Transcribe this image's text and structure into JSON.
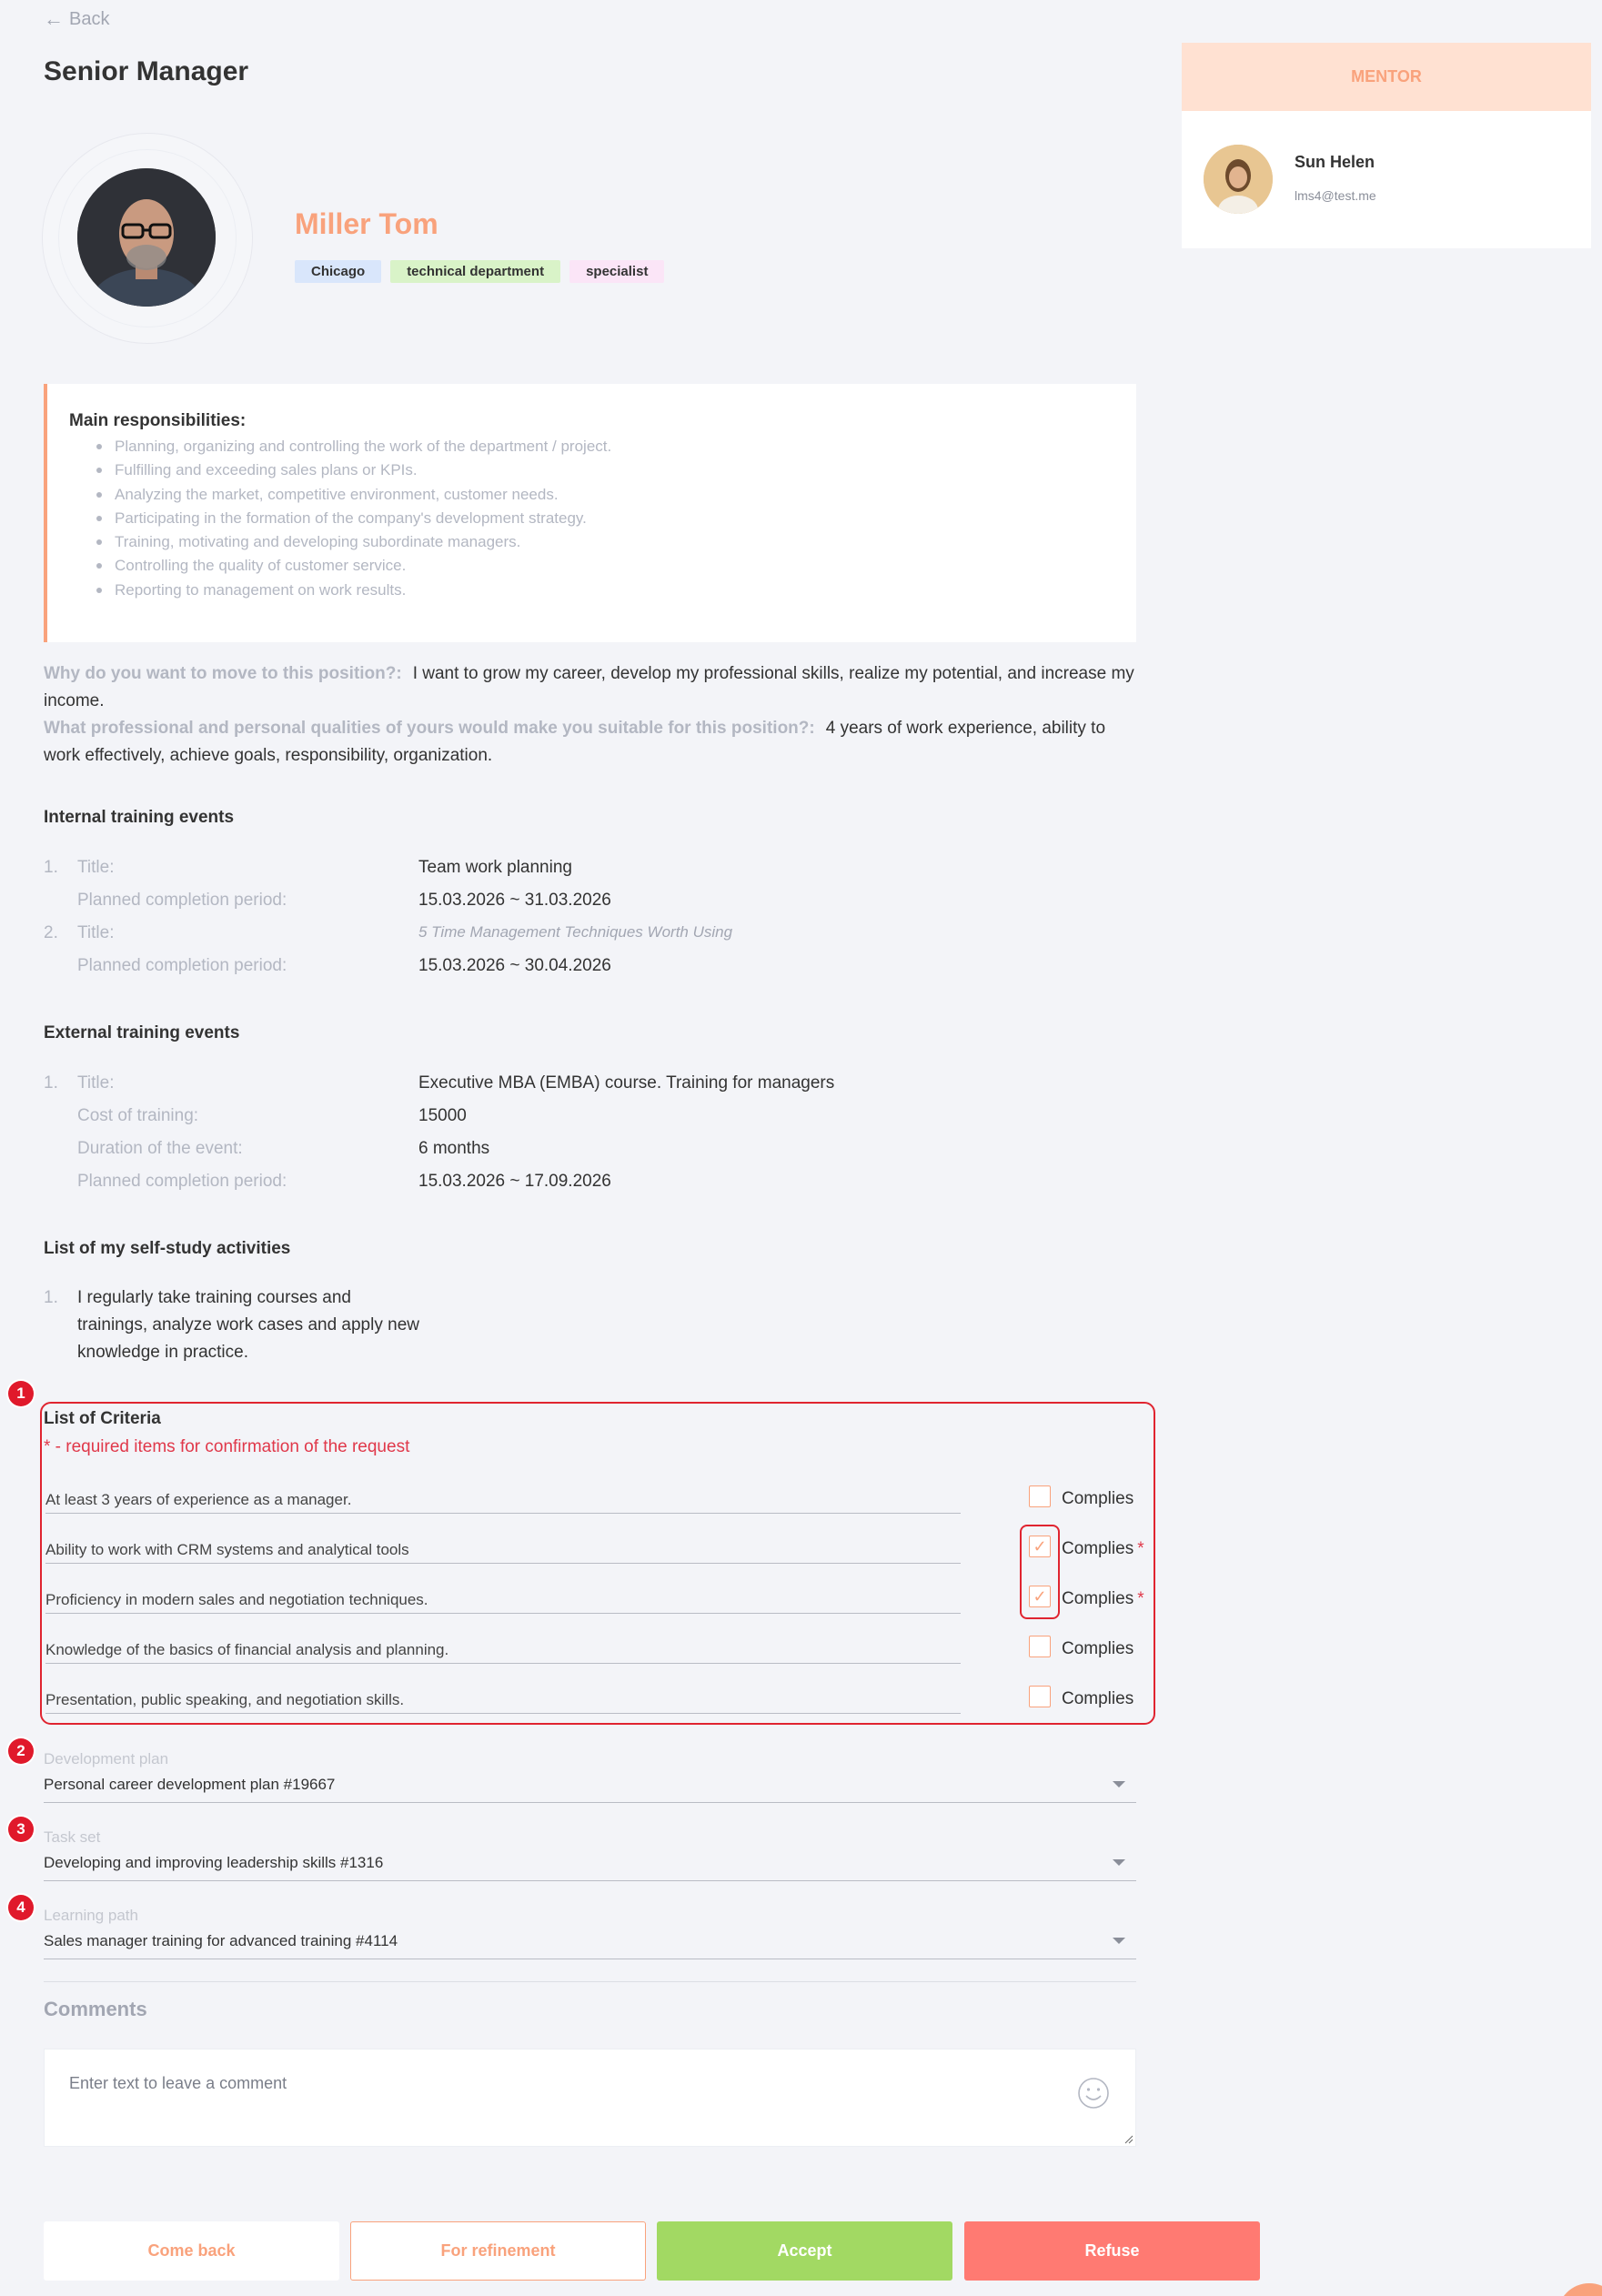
{
  "header": {
    "back_label": "Back",
    "page_title": "Senior Manager"
  },
  "profile": {
    "name": "Miller Tom",
    "tags": [
      "Chicago",
      "technical department",
      "specialist"
    ]
  },
  "mentor": {
    "heading": "MENTOR",
    "name": "Sun Helen",
    "email": "lms4@test.me"
  },
  "responsibilities": {
    "title": "Main responsibilities:",
    "items": [
      "Planning, organizing and controlling the work of the department / project.",
      "Fulfilling and exceeding sales plans or KPIs.",
      "Analyzing the market, competitive environment, customer needs.",
      "Participating in the formation of the company's development strategy.",
      "Training, motivating and developing subordinate managers.",
      "Controlling the quality of customer service.",
      "Reporting to management on work results."
    ]
  },
  "qa": [
    {
      "question": "Why do you want to move to this position?:",
      "answer": "I want to grow my career, develop my professional skills, realize my potential, and increase my income."
    },
    {
      "question": "What professional and personal qualities of yours would make you suitable for this position?:",
      "answer": "4 years of work experience, ability to work effectively, achieve goals, responsibility, organization."
    }
  ],
  "internal_training": {
    "title": "Internal training events",
    "rows": [
      {
        "num": "1.",
        "label": "Title:",
        "value": "Team work planning"
      },
      {
        "num": "",
        "label": "Planned completion period:",
        "value": "15.03.2026 ~ 31.03.2026"
      },
      {
        "num": "2.",
        "label": "Title:",
        "value": "5 Time Management Techniques Worth Using"
      },
      {
        "num": "",
        "label": "Planned completion period:",
        "value": "15.03.2026 ~ 30.04.2026"
      }
    ]
  },
  "external_training": {
    "title": "External training events",
    "rows": [
      {
        "num": "1.",
        "label": "Title:",
        "value": "Executive MBA (EMBA) course. Training for managers"
      },
      {
        "num": "",
        "label": "Cost of training:",
        "value": "15000"
      },
      {
        "num": "",
        "label": "Duration of the event:",
        "value": "6 months"
      },
      {
        "num": "",
        "label": "Planned completion period:",
        "value": "15.03.2026 ~ 17.09.2026"
      }
    ]
  },
  "self_study": {
    "title": "List of my self-study activities",
    "num": "1.",
    "text": "I regularly take training courses and trainings, analyze work cases and apply new knowledge in practice."
  },
  "criteria": {
    "title": "List of Criteria",
    "hint": "* - required items for confirmation of the request",
    "complies_label": "Complies",
    "required_mark": "*",
    "items": [
      {
        "label": "At least 3 years of experience as a manager.",
        "checked": false,
        "required": false
      },
      {
        "label": "Ability to work with CRM systems and analytical tools",
        "checked": true,
        "required": true
      },
      {
        "label": "Proficiency in modern sales and negotiation techniques.",
        "checked": true,
        "required": true
      },
      {
        "label": "Knowledge of the basics of financial analysis and planning.",
        "checked": false,
        "required": false
      },
      {
        "label": "Presentation, public speaking, and negotiation skills.",
        "checked": false,
        "required": false
      }
    ]
  },
  "markers": [
    "1",
    "2",
    "3",
    "4"
  ],
  "development_plan": {
    "label": "Development plan",
    "value": "Personal career development plan #19667"
  },
  "task_set": {
    "label": "Task set",
    "value": "Developing and improving leadership skills #1316"
  },
  "learning_path": {
    "label": "Learning path",
    "value": "Sales manager training for advanced training #4114"
  },
  "comments": {
    "title": "Comments",
    "placeholder": "Enter text to leave a comment"
  },
  "actions": {
    "come_back": "Come back",
    "refinement": "For refinement",
    "accept": "Accept",
    "refuse": "Refuse"
  },
  "colors": {
    "accent": "#f9a27c",
    "accept": "#a2d963",
    "refuse": "#ff7a72",
    "annotation_red": "#e02430"
  }
}
